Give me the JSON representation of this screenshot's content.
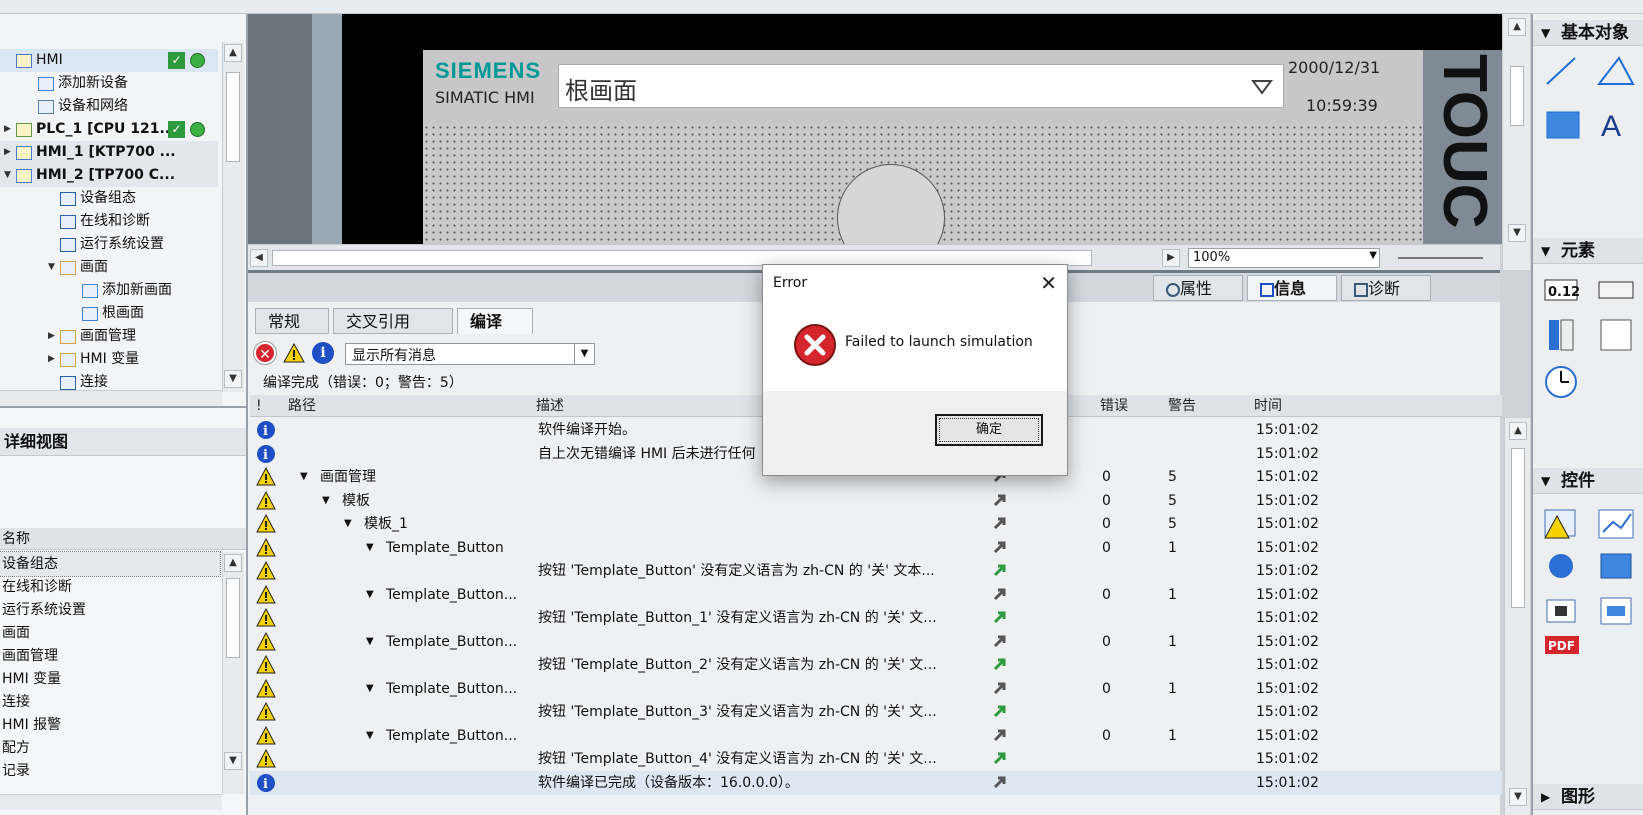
{
  "tree": {
    "items": [
      {
        "label": "HMI",
        "level": 0,
        "expand": ""
      },
      {
        "label": "添加新设备",
        "level": 1,
        "expand": ""
      },
      {
        "label": "设备和网络",
        "level": 1,
        "expand": ""
      },
      {
        "label": "PLC_1 [CPU 121...",
        "level": 0,
        "expand": "collapsed"
      },
      {
        "label": "HMI_1 [KTP700 ...",
        "level": 0,
        "expand": "collapsed"
      },
      {
        "label": "HMI_2 [TP700 C...",
        "level": 0,
        "expand": "expanded"
      },
      {
        "label": "设备组态",
        "level": 2,
        "expand": ""
      },
      {
        "label": "在线和诊断",
        "level": 2,
        "expand": ""
      },
      {
        "label": "运行系统设置",
        "level": 2,
        "expand": ""
      },
      {
        "label": "画面",
        "level": 2,
        "expand": "expanded"
      },
      {
        "label": "添加新画面",
        "level": 3,
        "expand": ""
      },
      {
        "label": "根画面",
        "level": 3,
        "expand": ""
      },
      {
        "label": "画面管理",
        "level": 2,
        "expand": "collapsed"
      },
      {
        "label": "HMI 变量",
        "level": 2,
        "expand": "collapsed"
      },
      {
        "label": "连接",
        "level": 2,
        "expand": ""
      }
    ]
  },
  "details": {
    "title": "详细视图",
    "column": "名称",
    "items": [
      "设备组态",
      "在线和诊断",
      "运行系统设置",
      "画面",
      "画面管理",
      "HMI 变量",
      "连接",
      "HMI 报警",
      "配方",
      "记录"
    ]
  },
  "editor": {
    "brand": "SIEMENS",
    "product": "SIMATIC HMI",
    "screen_name": "根画面",
    "date": "2000/12/31",
    "time": "10:59:39",
    "side_text": "TOUC",
    "zoom": "100%"
  },
  "inspector": {
    "tabs": [
      "属性",
      "信息",
      "诊断"
    ],
    "subtabs": [
      "常规",
      "交叉引用",
      "编译"
    ],
    "filter": "显示所有消息",
    "summary": "编译完成（错误：0；警告：5）",
    "columns": {
      "flag": "!",
      "path": "路径",
      "desc": "描述",
      "errors": "错误",
      "warnings": "警告",
      "time": "时间"
    },
    "rows": [
      {
        "type": "info",
        "path": "",
        "indent": 0,
        "desc": "软件编译开始。",
        "go": "",
        "err": "",
        "warn": "",
        "time": "15:01:02"
      },
      {
        "type": "info",
        "path": "",
        "indent": 0,
        "desc": "自上次无错编译 HMI 后未进行任何",
        "go": "",
        "err": "",
        "warn": "",
        "time": "15:01:02"
      },
      {
        "type": "warn",
        "path": "画面管理",
        "indent": 1,
        "desc": "",
        "go": "gray",
        "err": "0",
        "warn": "5",
        "time": "15:01:02"
      },
      {
        "type": "warn",
        "path": "模板",
        "indent": 2,
        "desc": "",
        "go": "gray",
        "err": "0",
        "warn": "5",
        "time": "15:01:02"
      },
      {
        "type": "warn",
        "path": "模板_1",
        "indent": 3,
        "desc": "",
        "go": "gray",
        "err": "0",
        "warn": "5",
        "time": "15:01:02"
      },
      {
        "type": "warn",
        "path": "Template_Button",
        "indent": 4,
        "desc": "",
        "go": "gray",
        "err": "0",
        "warn": "1",
        "time": "15:01:02"
      },
      {
        "type": "warn",
        "path": "",
        "indent": 0,
        "desc": "按钮 'Template_Button' 没有定义语言为 zh-CN 的 '关' 文本...",
        "go": "green",
        "err": "",
        "warn": "",
        "time": "15:01:02"
      },
      {
        "type": "warn",
        "path": "Template_Button...",
        "indent": 4,
        "desc": "",
        "go": "gray",
        "err": "0",
        "warn": "1",
        "time": "15:01:02"
      },
      {
        "type": "warn",
        "path": "",
        "indent": 0,
        "desc": "按钮 'Template_Button_1' 没有定义语言为 zh-CN 的 '关' 文...",
        "go": "green",
        "err": "",
        "warn": "",
        "time": "15:01:02"
      },
      {
        "type": "warn",
        "path": "Template_Button...",
        "indent": 4,
        "desc": "",
        "go": "gray",
        "err": "0",
        "warn": "1",
        "time": "15:01:02"
      },
      {
        "type": "warn",
        "path": "",
        "indent": 0,
        "desc": "按钮 'Template_Button_2' 没有定义语言为 zh-CN 的 '关' 文...",
        "go": "green",
        "err": "",
        "warn": "",
        "time": "15:01:02"
      },
      {
        "type": "warn",
        "path": "Template_Button...",
        "indent": 4,
        "desc": "",
        "go": "gray",
        "err": "0",
        "warn": "1",
        "time": "15:01:02"
      },
      {
        "type": "warn",
        "path": "",
        "indent": 0,
        "desc": "按钮 'Template_Button_3' 没有定义语言为 zh-CN 的 '关' 文...",
        "go": "green",
        "err": "",
        "warn": "",
        "time": "15:01:02"
      },
      {
        "type": "warn",
        "path": "Template_Button...",
        "indent": 4,
        "desc": "",
        "go": "gray",
        "err": "0",
        "warn": "1",
        "time": "15:01:02"
      },
      {
        "type": "warn",
        "path": "",
        "indent": 0,
        "desc": "按钮 'Template_Button_4' 没有定义语言为 zh-CN 的 '关' 文...",
        "go": "green",
        "err": "",
        "warn": "",
        "time": "15:01:02"
      },
      {
        "type": "info",
        "path": "",
        "indent": 0,
        "desc": "软件编译已完成（设备版本：16.0.0.0）。",
        "go": "gray",
        "err": "",
        "warn": "",
        "time": "15:01:02"
      }
    ]
  },
  "tasks": {
    "sections": [
      "基本对象",
      "元素",
      "控件",
      "图形"
    ]
  },
  "dialog": {
    "title": "Error",
    "message": "Failed to launch simulation",
    "ok_label": "确定"
  },
  "colors": {
    "accent": "#009999",
    "warn": "#f5d200",
    "info": "#1f4fc4",
    "error": "#d6262d"
  }
}
